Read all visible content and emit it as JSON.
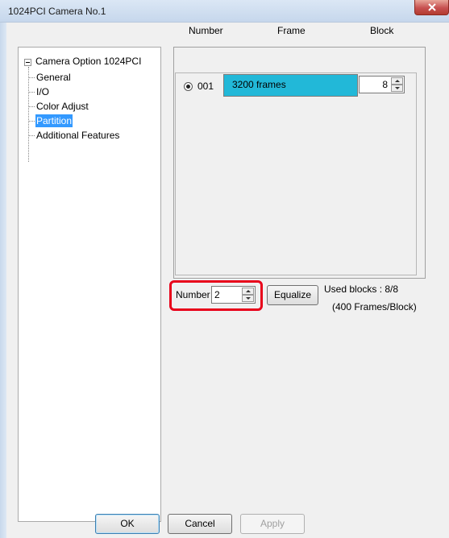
{
  "window": {
    "title": "1024PCI  Camera No.1"
  },
  "tree": {
    "root_label": "Camera Option 1024PCI",
    "items": [
      {
        "label": "General",
        "selected": false
      },
      {
        "label": "I/O",
        "selected": false
      },
      {
        "label": "Color Adjust",
        "selected": false
      },
      {
        "label": "Partition",
        "selected": true
      },
      {
        "label": "Additional Features",
        "selected": false
      }
    ]
  },
  "partition": {
    "headers": {
      "number": "Number",
      "frame": "Frame",
      "block": "Block"
    },
    "rows": [
      {
        "number": "001",
        "frames": "3200 frames",
        "block": "8",
        "checked": true
      }
    ],
    "number_label": "Number",
    "number_value": "2",
    "equalize_label": "Equalize",
    "used_blocks": "Used blocks : 8/8",
    "frames_per_block": "(400 Frames/Block)"
  },
  "buttons": {
    "ok": "OK",
    "cancel": "Cancel",
    "apply": "Apply"
  },
  "colors": {
    "frame_bar": "#22b8d8",
    "highlight": "#e8001a",
    "selection": "#3399ff"
  }
}
